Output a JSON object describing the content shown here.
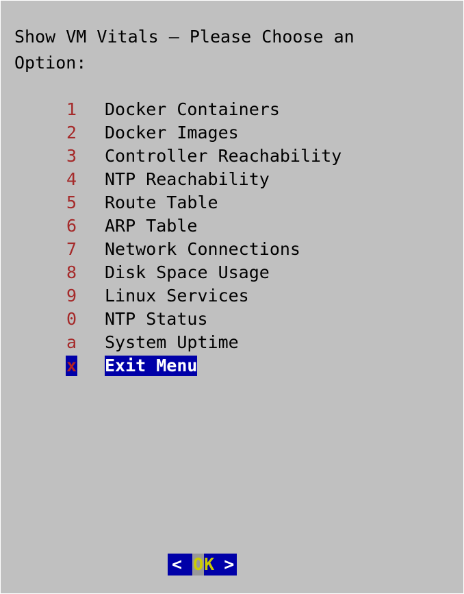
{
  "dialog": {
    "title_line1": "Show VM Vitals – Please Choose an",
    "title_line2": "Option:"
  },
  "menu": {
    "items": [
      {
        "key": "1",
        "label": "Docker Containers"
      },
      {
        "key": "2",
        "label": "Docker Images"
      },
      {
        "key": "3",
        "label": "Controller Reachability"
      },
      {
        "key": "4",
        "label": "NTP Reachability"
      },
      {
        "key": "5",
        "label": "Route Table"
      },
      {
        "key": "6",
        "label": "ARP Table"
      },
      {
        "key": "7",
        "label": "Network Connections"
      },
      {
        "key": "8",
        "label": "Disk Space Usage"
      },
      {
        "key": "9",
        "label": "Linux Services"
      },
      {
        "key": "0",
        "label": "NTP Status"
      },
      {
        "key": "a",
        "label": "System Uptime"
      },
      {
        "key": "x",
        "label": "Exit Menu",
        "selected": true
      }
    ]
  },
  "buttons": {
    "ok": {
      "left_bracket": "<",
      "label_first": "O",
      "label_rest": "K",
      "right_bracket": ">"
    }
  },
  "colors": {
    "dialog_background": "#c0c0c0",
    "hotkey": "#a52a2a",
    "selection_background": "#0000a8",
    "selection_text": "#ffffff",
    "button_label": "#cccc00"
  }
}
